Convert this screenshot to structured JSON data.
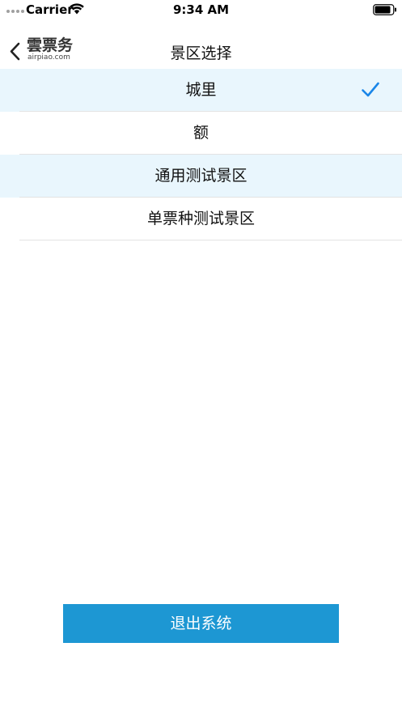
{
  "status_bar": {
    "carrier": "Carrier",
    "time": "9:34 AM"
  },
  "nav": {
    "back_icon": "chevron-left-icon",
    "logo_main": "雲票务",
    "logo_sub": "airpiao.com",
    "title": "景区选择"
  },
  "list": {
    "items": [
      {
        "label": "城里",
        "selected": true
      },
      {
        "label": "额",
        "selected": false
      },
      {
        "label": "通用测试景区",
        "selected": false
      },
      {
        "label": "单票种测试景区",
        "selected": false
      }
    ],
    "check_icon": "checkmark-icon",
    "accent_color": "#1a86e8"
  },
  "footer": {
    "logout_label": "退出系统",
    "button_color": "#1d97d3"
  }
}
